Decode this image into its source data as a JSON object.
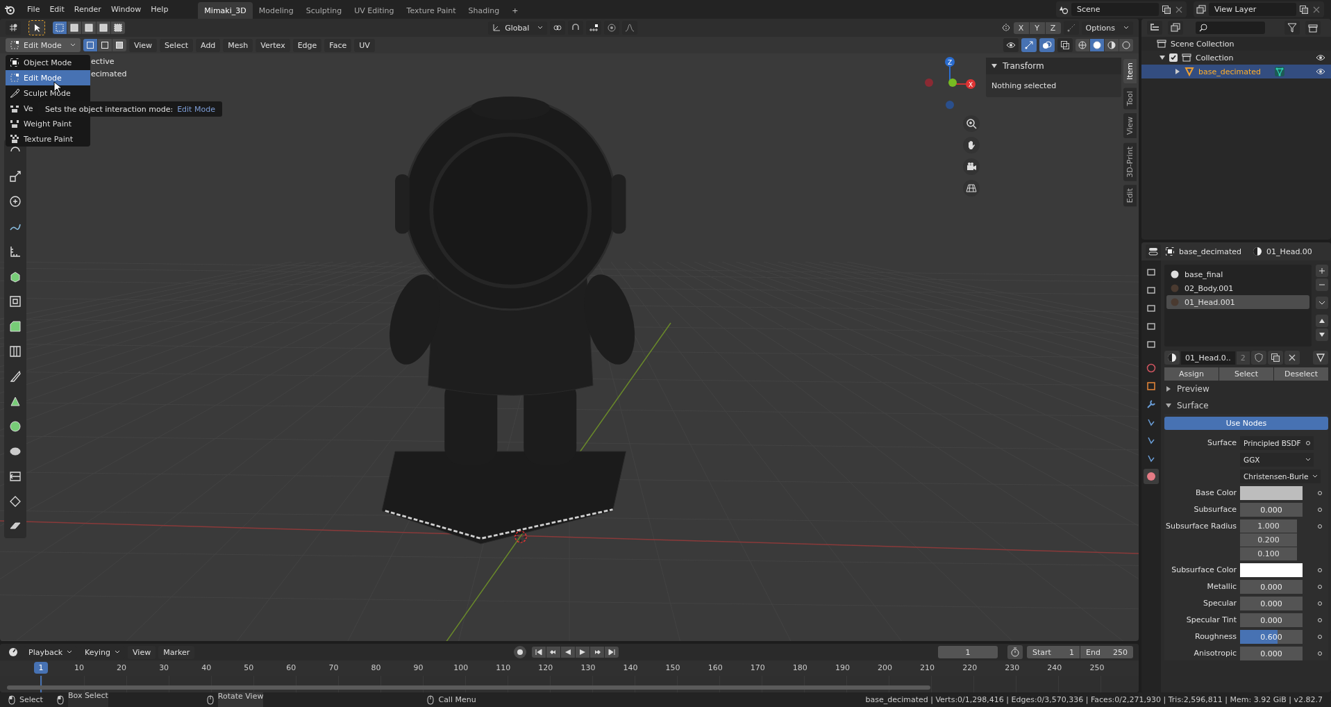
{
  "top_bar": {
    "menus": [
      "File",
      "Edit",
      "Render",
      "Window",
      "Help"
    ],
    "workspaces": [
      {
        "label": "Mimaki_3D",
        "selected": true
      },
      {
        "label": "Modeling",
        "selected": false
      },
      {
        "label": "Sculpting",
        "selected": false
      },
      {
        "label": "UV Editing",
        "selected": false
      },
      {
        "label": "Texture Paint",
        "selected": false
      },
      {
        "label": "Shading",
        "selected": false
      }
    ],
    "add_tab": "+",
    "scene": "Scene",
    "view_layer": "View Layer"
  },
  "tool_header": {
    "select_modes": [
      {
        "selected": true
      },
      {
        "selected": false
      },
      {
        "selected": false
      },
      {
        "selected": false
      },
      {
        "selected": false
      }
    ],
    "orientation": "Global",
    "mirror_axes": [
      "X",
      "Y",
      "Z"
    ],
    "options": "Options"
  },
  "viewport_header": {
    "mode": "Edit Mode",
    "element_modes": [
      {
        "selected": true
      },
      {
        "selected": false
      },
      {
        "selected": false
      }
    ],
    "menus": [
      "View",
      "Select",
      "Add",
      "Mesh",
      "Vertex",
      "Edge",
      "Face",
      "UV"
    ],
    "gizmos_on": true,
    "overlays_on": true,
    "shading_modes": [
      {
        "selected": false
      },
      {
        "selected": true
      },
      {
        "selected": false
      },
      {
        "selected": false
      }
    ]
  },
  "viewport": {
    "overlay_text": [
      "ective",
      "ecimated"
    ],
    "gizmo_labels": [
      "Z",
      "X"
    ]
  },
  "mode_menu": {
    "items": [
      {
        "label": "Object Mode",
        "selected": false
      },
      {
        "label": "Edit Mode",
        "selected": true
      },
      {
        "label": "Sculpt Mode",
        "selected": false
      },
      {
        "label": "Ve",
        "selected": false
      },
      {
        "label": "Weight Paint",
        "selected": false
      },
      {
        "label": "Texture Paint",
        "selected": false
      }
    ]
  },
  "tooltip": {
    "text": "Sets the object interaction mode:",
    "value": "Edit Mode"
  },
  "sidebar": {
    "tabs": [
      {
        "label": "Item",
        "selected": true
      },
      {
        "label": "Tool",
        "selected": false
      },
      {
        "label": "View",
        "selected": false
      },
      {
        "label": "3D-Print",
        "selected": false
      },
      {
        "label": "Edit",
        "selected": false
      }
    ],
    "panel": {
      "title": "Transform",
      "expanded": true,
      "message": "Nothing selected"
    }
  },
  "outliner": {
    "rows": [
      {
        "label": "Scene Collection",
        "children": [
          {
            "label": "Collection",
            "checked": true,
            "expanded": true,
            "children": [
              {
                "label": "base_decimated",
                "selected": true,
                "expanded": false
              }
            ]
          }
        ]
      }
    ]
  },
  "properties": {
    "object": "base_decimated",
    "material": "01_Head.00",
    "tabs": [
      {
        "selected": false
      },
      {
        "selected": false
      },
      {
        "selected": false
      },
      {
        "selected": false
      },
      {
        "selected": false
      },
      {
        "selected": false
      },
      {
        "selected": false
      },
      {
        "selected": false
      },
      {
        "selected": false
      },
      {
        "selected": false
      },
      {
        "selected": false
      },
      {
        "selected": true
      }
    ],
    "slots": [
      {
        "label": "base_final",
        "selected": false
      },
      {
        "label": "02_Body.001",
        "selected": false
      },
      {
        "label": "01_Head.001",
        "selected": true
      }
    ],
    "datablock": {
      "name": "01_Head.0..",
      "users": "2"
    },
    "slot_buttons": [
      "Assign",
      "Select",
      "Deselect"
    ],
    "panels": [
      {
        "title": "Preview",
        "expanded": false
      },
      {
        "title": "Surface",
        "expanded": true
      }
    ],
    "use_nodes": "Use Nodes",
    "fields": [
      {
        "kind": "link",
        "label": "Surface",
        "value": "Principled BSDF"
      },
      {
        "kind": "dropdown",
        "value": "GGX"
      },
      {
        "kind": "dropdown",
        "value": "Christensen-Burle"
      },
      {
        "kind": "color",
        "label": "Base Color",
        "color": "#bdbdbd"
      },
      {
        "kind": "slider",
        "label": "Subsurface",
        "value": "0.000"
      },
      {
        "kind": "vector",
        "label": "Subsurface Radius",
        "values": [
          "1.000",
          "0.200",
          "0.100"
        ]
      },
      {
        "kind": "color",
        "label": "Subsurface Color",
        "color": "#ffffff"
      },
      {
        "kind": "slider",
        "label": "Metallic",
        "value": "0.000"
      },
      {
        "kind": "slider",
        "label": "Specular",
        "value": "0.000"
      },
      {
        "kind": "slider",
        "label": "Specular Tint",
        "value": "0.000"
      },
      {
        "kind": "slider",
        "label": "Roughness",
        "value": "0.600",
        "level": 0.6
      },
      {
        "kind": "slider",
        "label": "Anisotropic",
        "value": "0.000"
      }
    ]
  },
  "timeline": {
    "menus": [
      "Playback",
      "Keying",
      "View",
      "Marker"
    ],
    "current_frame": "1",
    "start_label": "Start",
    "start": "1",
    "end_label": "End",
    "end": "250",
    "playhead": "1",
    "ticks": [
      "10",
      "20",
      "30",
      "40",
      "50",
      "60",
      "70",
      "80",
      "90",
      "100",
      "110",
      "120",
      "130",
      "140",
      "150",
      "160",
      "170",
      "180",
      "190",
      "200",
      "210",
      "220",
      "230",
      "240",
      "250"
    ]
  },
  "status_bar": {
    "hints": [
      "Select",
      "Box Select",
      "Rotate View",
      "Call Menu"
    ],
    "stats": "base_decimated | Verts:0/1,298,416 | Edges:0/3,570,336 | Faces:0/2,271,930 | Tris:2,596,811 | Mem: 3.92 GiB | v2.82.7"
  }
}
